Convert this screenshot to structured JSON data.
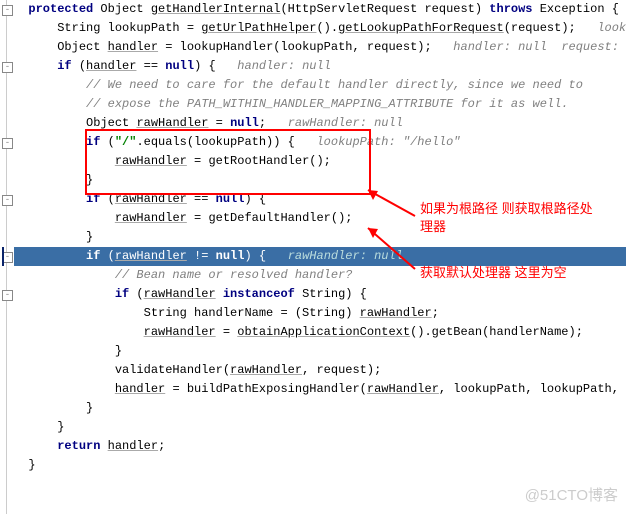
{
  "lines": {
    "l0a": "protected",
    "l0b": " Object ",
    "l0c": "getHandlerInternal",
    "l0d": "(HttpServletRequest request) ",
    "l0e": "throws",
    "l0f": " Exception {",
    "l1a": "    String lookupPath = ",
    "l1b": "getUrlPathHelper",
    "l1c": "().",
    "l1d": "getLookupPathForRequest",
    "l1e": "(request);   ",
    "l1f": "lookup",
    "l2a": "    Object ",
    "l2b": "handler",
    "l2c": " = lookupHandler(lookupPath, request);   ",
    "l2d": "handler: null  request: \"S",
    "l3a": "    ",
    "l3b": "if",
    "l3c": " (",
    "l3d": "handler",
    "l3e": " == ",
    "l3f": "null",
    "l3g": ") {   ",
    "l3h": "handler: null",
    "l4": "        // We need to care for the default handler directly, since we need to",
    "l5": "        // expose the PATH_WITHIN_HANDLER_MAPPING_ATTRIBUTE for it as well.",
    "l6a": "        Object ",
    "l6b": "rawHandler",
    "l6c": " = ",
    "l6d": "null",
    "l6e": ";   ",
    "l6f": "rawHandler: null",
    "l7a": "        ",
    "l7b": "if",
    "l7c": " (",
    "l7d": "\"/\"",
    "l7e": ".equals(lookupPath)) {   ",
    "l7f": "lookupPath: \"/hello\"",
    "l8a": "            ",
    "l8b": "rawHandler",
    "l8c": " = getRootHandler();",
    "l9": "        }",
    "l10a": "        ",
    "l10b": "if",
    "l10c": " (",
    "l10d": "rawHandler",
    "l10e": " == ",
    "l10f": "null",
    "l10g": ") {",
    "l11a": "            ",
    "l11b": "rawHandler",
    "l11c": " = getDefaultHandler();",
    "l12": "        }",
    "l13a": "        ",
    "l13b": "if",
    "l13c": " (",
    "l13d": "rawHandler",
    "l13e": " != ",
    "l13f": "null",
    "l13g": ") {   ",
    "l13h": "rawHandler: null",
    "l14": "            // Bean name or resolved handler?",
    "l15a": "            ",
    "l15b": "if",
    "l15c": " (",
    "l15d": "rawHandler",
    "l15e": " ",
    "l15f": "instanceof",
    "l15g": " String) {",
    "l16a": "                String handlerName = (String) ",
    "l16b": "rawHandler",
    "l16c": ";",
    "l17a": "                ",
    "l17b": "rawHandler",
    "l17c": " = ",
    "l17d": "obtainApplicationContext",
    "l17e": "().getBean(handlerName);",
    "l18": "            }",
    "l19a": "            validateHandler(",
    "l19b": "rawHandler",
    "l19c": ", request);",
    "l20a": "            ",
    "l20b": "handler",
    "l20c": " = buildPathExposingHandler(",
    "l20d": "rawHandler",
    "l20e": ", lookupPath, lookupPath, ",
    "l21": "        }",
    "l22": "    }",
    "l23a": "    ",
    "l23b": "return",
    "l23c": " ",
    "l23d": "handler",
    "l23e": ";",
    "l24": "}"
  },
  "annotations": {
    "a1": "如果为根路径 则获取根路径处理器",
    "a2": "获取默认处理器 这里为空"
  },
  "watermark": "@51CTO博客"
}
